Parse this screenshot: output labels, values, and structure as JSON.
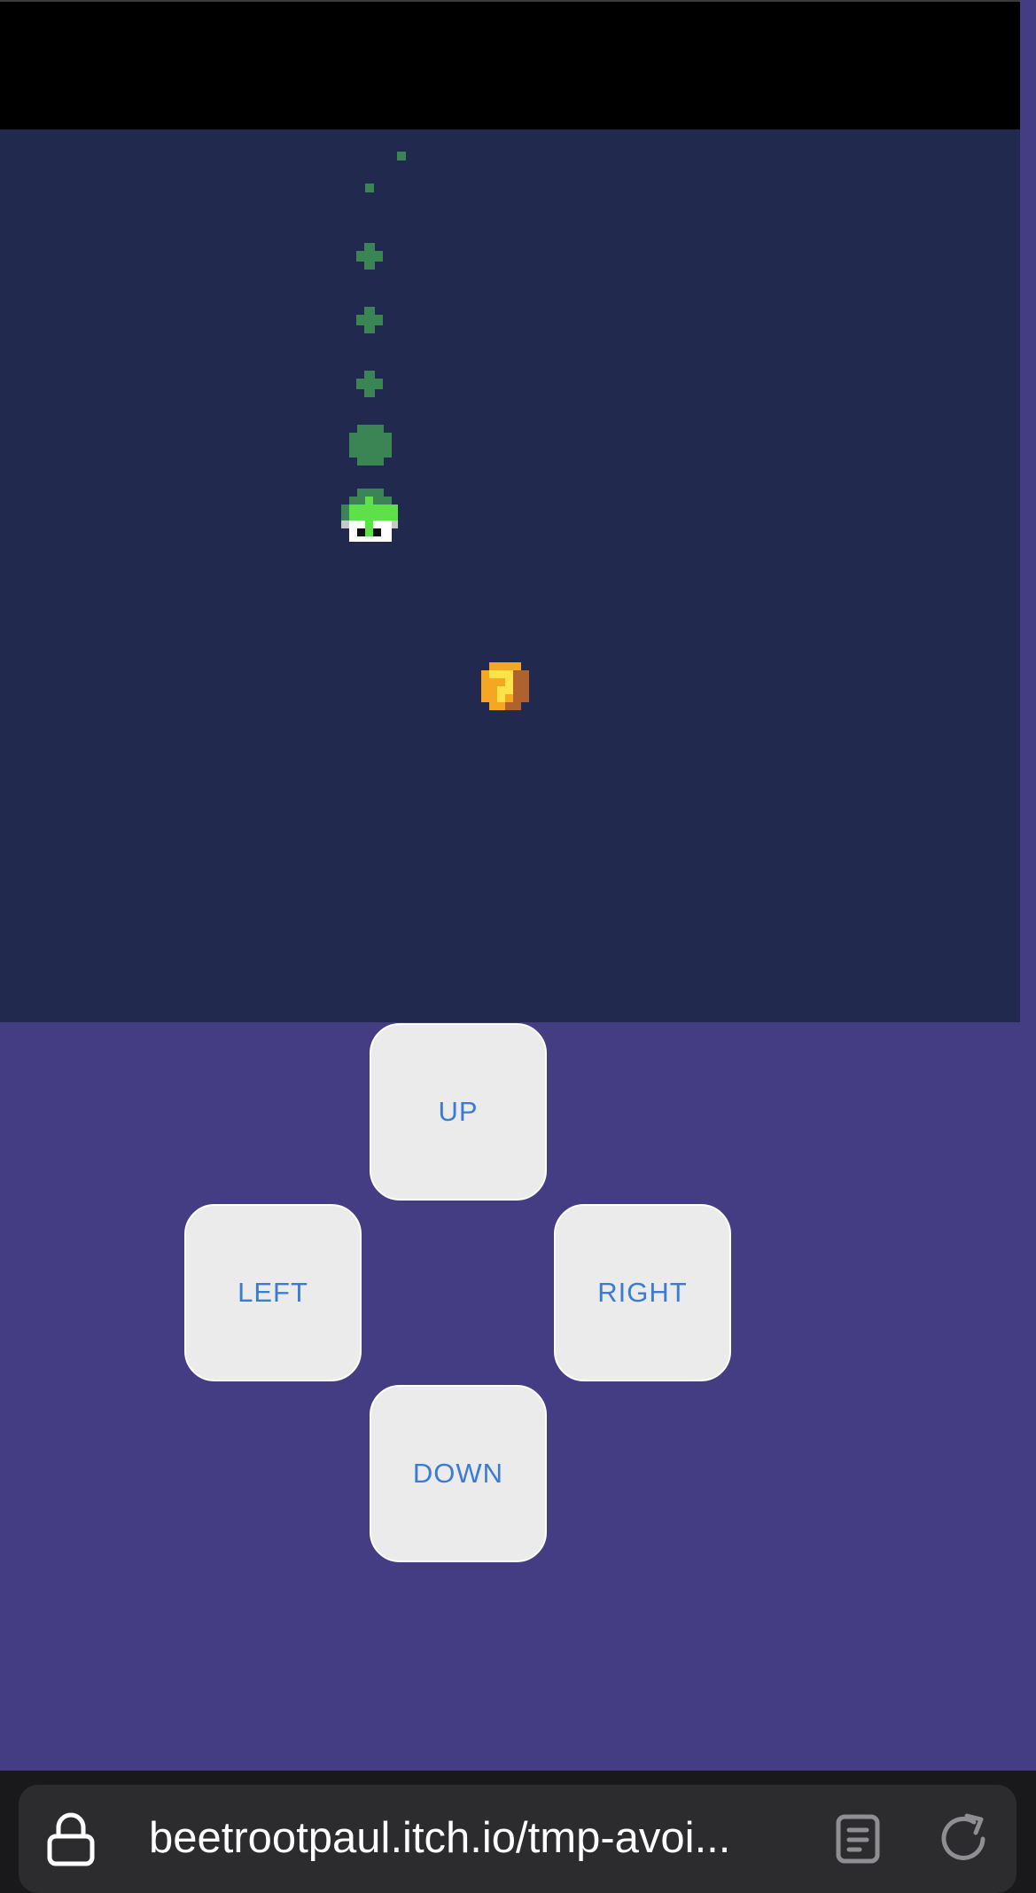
{
  "controls": {
    "up_label": "UP",
    "left_label": "LEFT",
    "right_label": "RIGHT",
    "down_label": "DOWN"
  },
  "browser": {
    "url": "beetrootpaul.itch.io/tmp-avoi...",
    "icons": [
      "lock-icon",
      "reader-mode-icon",
      "reload-icon"
    ]
  },
  "game": {
    "sprites": [
      "player-blob-sprite",
      "coin-sprite",
      "trail-sprite"
    ]
  },
  "colors": {
    "page_background": "#453d84",
    "game_background": "#21294e",
    "button_background": "#ebebeb",
    "button_text": "#3a7bd5",
    "trail": "#3a8553",
    "player": "#5ee04b",
    "coin": "#f5a623"
  }
}
